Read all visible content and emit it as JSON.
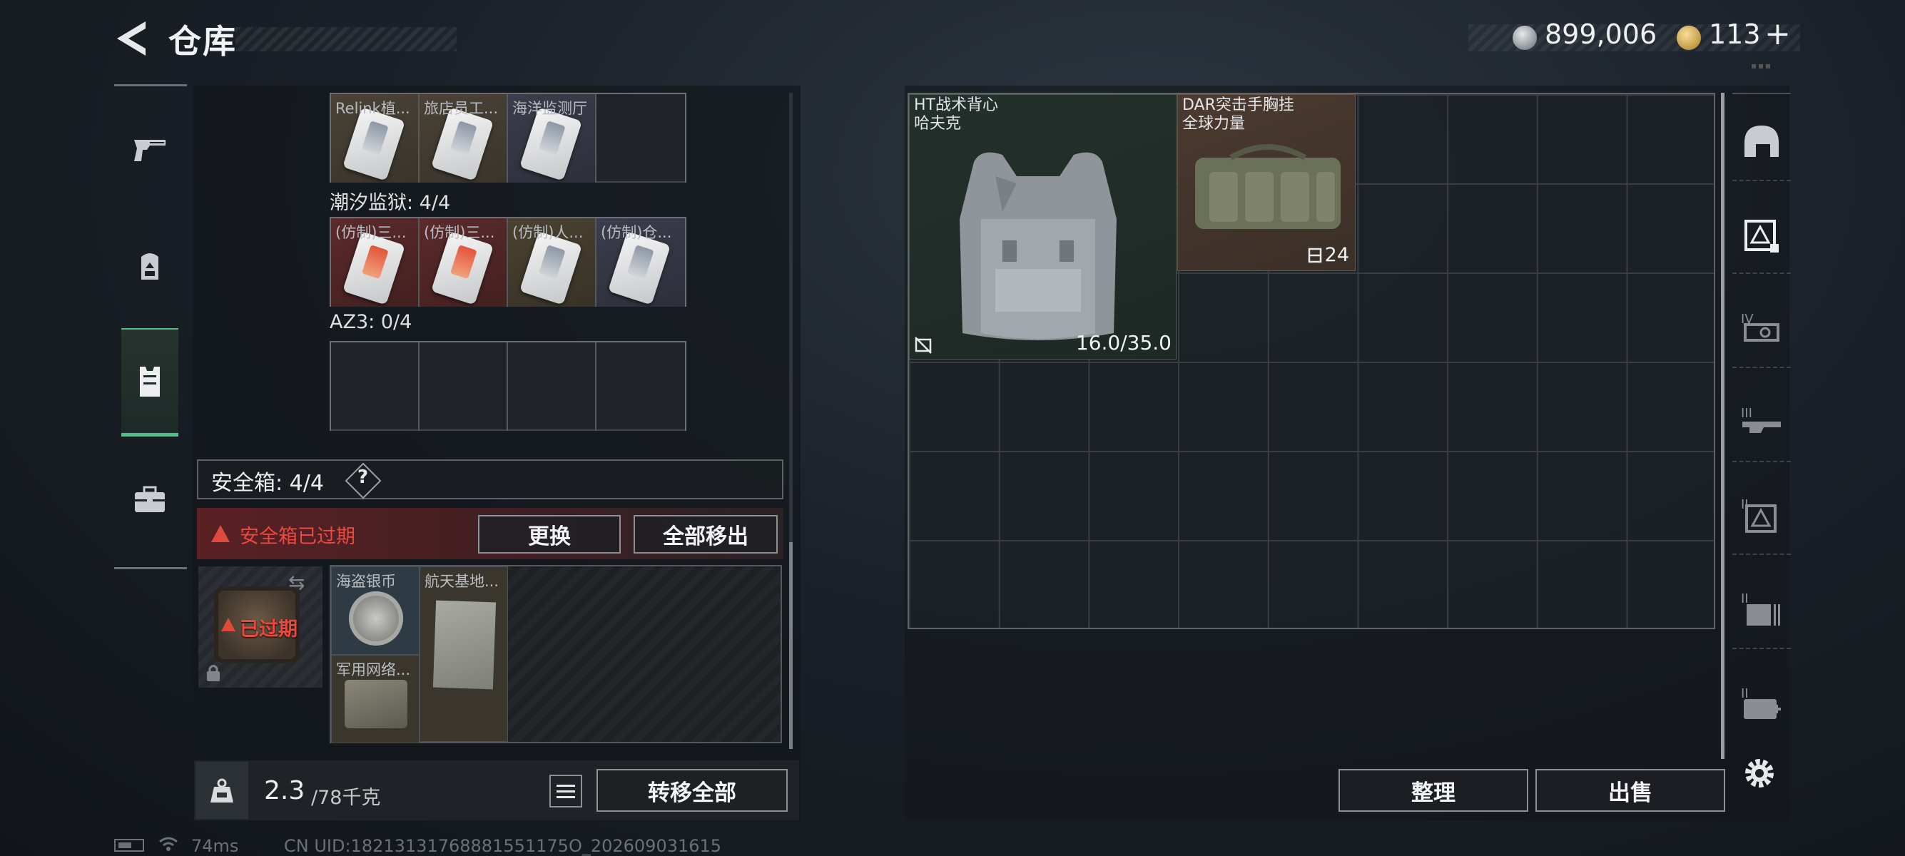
{
  "header": {
    "title": "仓库"
  },
  "currency": {
    "silver": "899,006",
    "gold": "113",
    "plus": "+"
  },
  "sidebar": {
    "items": [
      {
        "icon": "pistol-icon"
      },
      {
        "icon": "backpack-icon"
      },
      {
        "icon": "vest-icon",
        "active": true
      },
      {
        "icon": "toolbox-icon"
      }
    ]
  },
  "groups": {
    "row1_labels": [
      "Relink植...",
      "旅店员工...",
      "海洋监测厅",
      ""
    ],
    "chaoxi": {
      "title": "潮汐监狱: 4/4",
      "labels": [
        "(仿制)三...",
        "(仿制)三...",
        "(仿制)人...",
        "(仿制)仓..."
      ]
    },
    "az3": {
      "title": "AZ3: 0/4"
    }
  },
  "safe_box": {
    "title": "安全箱: 4/4",
    "help": "?",
    "expired_notice": "安全箱已过期",
    "replace_label": "更换",
    "move_all_label": "全部移出",
    "case_status": "已过期",
    "items": [
      "海盗银币",
      "航天基地...",
      "军用网络..."
    ]
  },
  "bottom": {
    "weight_current": "2.3",
    "weight_max": "/78千克",
    "transfer_all_label": "转移全部"
  },
  "status_bar": {
    "ping": "74ms",
    "uid": "CN UID:18213131768881551175O_202609031615"
  },
  "storage": {
    "vest": {
      "name": "HT战术背心\n哈夫克",
      "durability": "16.0/35.0"
    },
    "rig": {
      "name": "DAR突击手胸挂\n全球力量",
      "count": "24"
    },
    "sort_label": "整理",
    "sell_label": "出售"
  },
  "right_sidebar": {
    "items": [
      "helmet-icon",
      "armor-tier-icon",
      "tier-iv-icon",
      "tier-iii-weapon-icon",
      "tier-ii-armor-icon",
      "tier-ii-storage-icon",
      "tier-ii-medical-icon"
    ]
  },
  "colors": {
    "accent_green": "#4fbf85",
    "warning_red": "#ea4a3e"
  }
}
